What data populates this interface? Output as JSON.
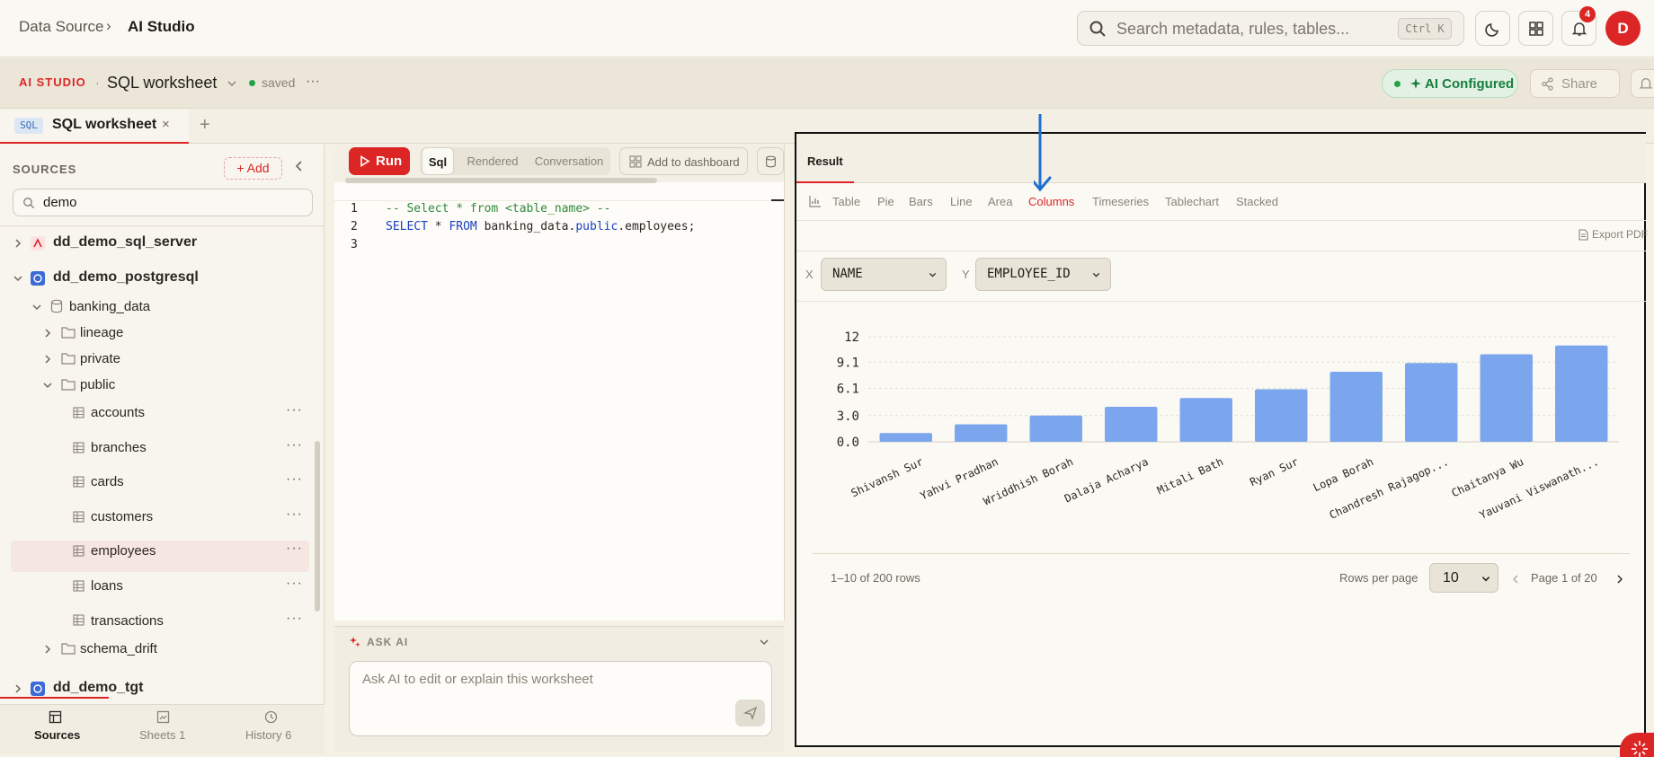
{
  "breadcrumb": {
    "root": "Data Source",
    "sep": "›",
    "current": "AI Studio"
  },
  "search": {
    "placeholder": "Search metadata, rules, tables...",
    "shortcut": "Ctrl K"
  },
  "notifications": {
    "count": "4"
  },
  "user": {
    "initial": "D"
  },
  "worksheet_bar": {
    "brand": "AI STUDIO",
    "dot": "·",
    "name": "SQL worksheet",
    "status": "saved",
    "ai_status": "AI Configured",
    "share_label": "Share"
  },
  "tabs": [
    {
      "chip": "SQL",
      "label": "SQL worksheet",
      "close": "×"
    }
  ],
  "add_tab": "+",
  "sidebar": {
    "title": "SOURCES",
    "add_label": "+ Add",
    "filter_value": "demo",
    "tree": {
      "sql_server": "dd_demo_sql_server",
      "postgres": "dd_demo_postgresql",
      "db": "banking_data",
      "lineage": "lineage",
      "private": "private",
      "public": "public",
      "tables": [
        "accounts",
        "branches",
        "cards",
        "customers",
        "employees",
        "loans",
        "transactions"
      ],
      "schema_drift": "schema_drift",
      "tgt": "dd_demo_tgt"
    },
    "nav": {
      "sources": "Sources",
      "sheets": "Sheets",
      "sheets_count": "1",
      "history": "History",
      "history_count": "6"
    }
  },
  "editor": {
    "run_label": "Run",
    "modes": [
      "Sql",
      "Rendered",
      "Conversation"
    ],
    "dashboard_label": "Add to dashboard",
    "lines": [
      "1",
      "2",
      "3"
    ],
    "line1": "-- Select * from <table_name> --",
    "line2_kw1": "SELECT",
    "line2_mid": " * ",
    "line2_kw2": "FROM",
    "line2_rest_a": " banking_data.",
    "line2_kw3": "public",
    "line2_rest_b": ".employees;"
  },
  "ask_ai": {
    "title": "ASK AI",
    "placeholder": "Ask AI to edit or explain this worksheet"
  },
  "results": {
    "tab_label": "Result",
    "chart_types": [
      "Table",
      "Pie",
      "Bars",
      "Line",
      "Area",
      "Columns",
      "Timeseries",
      "Tablechart",
      "Stacked"
    ],
    "active_chart_type": "Columns",
    "export_label": "Export PDF",
    "x_label": "X",
    "x_field": "NAME",
    "y_label": "Y",
    "y_field": "EMPLOYEE_ID",
    "rows_info": "1–10 of 200 rows",
    "rows_per_page_label": "Rows per page",
    "rows_per_page": "10",
    "page_info": "Page 1 of 20"
  },
  "colors": {
    "accent": "#dc2626",
    "bar": "#7ba6ee",
    "ok": "#15803d"
  },
  "chart_data": {
    "type": "bar",
    "categories": [
      "Shivansh Sur",
      "Yahvi Pradhan",
      "Wriddhish Borah",
      "Dalaja Acharya",
      "Mitali Bath",
      "Ryan Sur",
      "Lopa Borah",
      "Chandresh Rajagop...",
      "Chaitanya Wu",
      "Yauvani Viswanath..."
    ],
    "values": [
      1,
      2,
      3,
      4,
      5,
      6,
      8,
      9,
      10,
      11
    ],
    "yticks": [
      "0.0",
      "3.0",
      "6.1",
      "9.1",
      "12"
    ],
    "ylim": [
      0,
      12
    ],
    "grid": true
  }
}
